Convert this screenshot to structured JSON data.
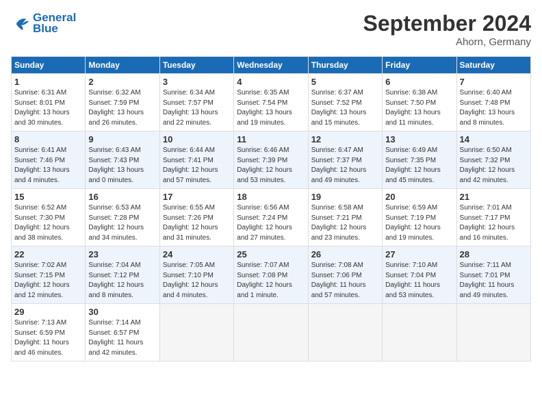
{
  "header": {
    "logo_line1": "General",
    "logo_line2": "Blue",
    "month": "September 2024",
    "location": "Ahorn, Germany"
  },
  "days_of_week": [
    "Sunday",
    "Monday",
    "Tuesday",
    "Wednesday",
    "Thursday",
    "Friday",
    "Saturday"
  ],
  "weeks": [
    [
      {
        "num": "1",
        "info": "Sunrise: 6:31 AM\nSunset: 8:01 PM\nDaylight: 13 hours\nand 30 minutes."
      },
      {
        "num": "2",
        "info": "Sunrise: 6:32 AM\nSunset: 7:59 PM\nDaylight: 13 hours\nand 26 minutes."
      },
      {
        "num": "3",
        "info": "Sunrise: 6:34 AM\nSunset: 7:57 PM\nDaylight: 13 hours\nand 22 minutes."
      },
      {
        "num": "4",
        "info": "Sunrise: 6:35 AM\nSunset: 7:54 PM\nDaylight: 13 hours\nand 19 minutes."
      },
      {
        "num": "5",
        "info": "Sunrise: 6:37 AM\nSunset: 7:52 PM\nDaylight: 13 hours\nand 15 minutes."
      },
      {
        "num": "6",
        "info": "Sunrise: 6:38 AM\nSunset: 7:50 PM\nDaylight: 13 hours\nand 11 minutes."
      },
      {
        "num": "7",
        "info": "Sunrise: 6:40 AM\nSunset: 7:48 PM\nDaylight: 13 hours\nand 8 minutes."
      }
    ],
    [
      {
        "num": "8",
        "info": "Sunrise: 6:41 AM\nSunset: 7:46 PM\nDaylight: 13 hours\nand 4 minutes."
      },
      {
        "num": "9",
        "info": "Sunrise: 6:43 AM\nSunset: 7:43 PM\nDaylight: 13 hours\nand 0 minutes."
      },
      {
        "num": "10",
        "info": "Sunrise: 6:44 AM\nSunset: 7:41 PM\nDaylight: 12 hours\nand 57 minutes."
      },
      {
        "num": "11",
        "info": "Sunrise: 6:46 AM\nSunset: 7:39 PM\nDaylight: 12 hours\nand 53 minutes."
      },
      {
        "num": "12",
        "info": "Sunrise: 6:47 AM\nSunset: 7:37 PM\nDaylight: 12 hours\nand 49 minutes."
      },
      {
        "num": "13",
        "info": "Sunrise: 6:49 AM\nSunset: 7:35 PM\nDaylight: 12 hours\nand 45 minutes."
      },
      {
        "num": "14",
        "info": "Sunrise: 6:50 AM\nSunset: 7:32 PM\nDaylight: 12 hours\nand 42 minutes."
      }
    ],
    [
      {
        "num": "15",
        "info": "Sunrise: 6:52 AM\nSunset: 7:30 PM\nDaylight: 12 hours\nand 38 minutes."
      },
      {
        "num": "16",
        "info": "Sunrise: 6:53 AM\nSunset: 7:28 PM\nDaylight: 12 hours\nand 34 minutes."
      },
      {
        "num": "17",
        "info": "Sunrise: 6:55 AM\nSunset: 7:26 PM\nDaylight: 12 hours\nand 31 minutes."
      },
      {
        "num": "18",
        "info": "Sunrise: 6:56 AM\nSunset: 7:24 PM\nDaylight: 12 hours\nand 27 minutes."
      },
      {
        "num": "19",
        "info": "Sunrise: 6:58 AM\nSunset: 7:21 PM\nDaylight: 12 hours\nand 23 minutes."
      },
      {
        "num": "20",
        "info": "Sunrise: 6:59 AM\nSunset: 7:19 PM\nDaylight: 12 hours\nand 19 minutes."
      },
      {
        "num": "21",
        "info": "Sunrise: 7:01 AM\nSunset: 7:17 PM\nDaylight: 12 hours\nand 16 minutes."
      }
    ],
    [
      {
        "num": "22",
        "info": "Sunrise: 7:02 AM\nSunset: 7:15 PM\nDaylight: 12 hours\nand 12 minutes."
      },
      {
        "num": "23",
        "info": "Sunrise: 7:04 AM\nSunset: 7:12 PM\nDaylight: 12 hours\nand 8 minutes."
      },
      {
        "num": "24",
        "info": "Sunrise: 7:05 AM\nSunset: 7:10 PM\nDaylight: 12 hours\nand 4 minutes."
      },
      {
        "num": "25",
        "info": "Sunrise: 7:07 AM\nSunset: 7:08 PM\nDaylight: 12 hours\nand 1 minute."
      },
      {
        "num": "26",
        "info": "Sunrise: 7:08 AM\nSunset: 7:06 PM\nDaylight: 11 hours\nand 57 minutes."
      },
      {
        "num": "27",
        "info": "Sunrise: 7:10 AM\nSunset: 7:04 PM\nDaylight: 11 hours\nand 53 minutes."
      },
      {
        "num": "28",
        "info": "Sunrise: 7:11 AM\nSunset: 7:01 PM\nDaylight: 11 hours\nand 49 minutes."
      }
    ],
    [
      {
        "num": "29",
        "info": "Sunrise: 7:13 AM\nSunset: 6:59 PM\nDaylight: 11 hours\nand 46 minutes."
      },
      {
        "num": "30",
        "info": "Sunrise: 7:14 AM\nSunset: 6:57 PM\nDaylight: 11 hours\nand 42 minutes."
      },
      {
        "num": "",
        "info": ""
      },
      {
        "num": "",
        "info": ""
      },
      {
        "num": "",
        "info": ""
      },
      {
        "num": "",
        "info": ""
      },
      {
        "num": "",
        "info": ""
      }
    ]
  ]
}
